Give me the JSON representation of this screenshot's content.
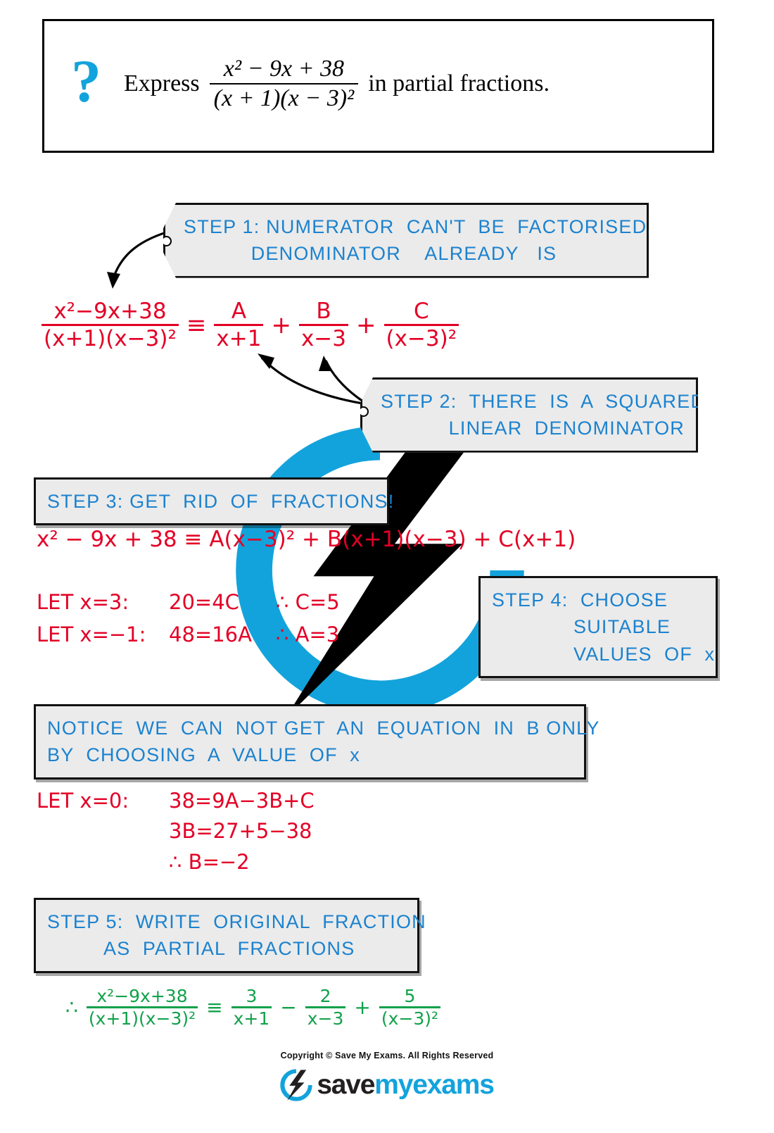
{
  "question": {
    "icon": "question-mark-icon",
    "lead": "Express",
    "trail": "in partial fractions.",
    "fraction": {
      "numerator": "x² − 9x + 38",
      "denominator": "(x + 1)(x − 3)²"
    }
  },
  "steps": [
    {
      "id": "step1",
      "lines": [
        "STEP 1: NUMERATOR  CAN'T  BE  FACTORISED,",
        "DENOMINATOR    ALREADY   IS"
      ]
    },
    {
      "id": "step2",
      "lines": [
        "STEP 2:  THERE  IS  A  SQUARED",
        "LINEAR  DENOMINATOR"
      ]
    },
    {
      "id": "step3",
      "lines": [
        "STEP 3: GET  RID  OF  FRACTIONS!"
      ]
    },
    {
      "id": "step4",
      "lines": [
        "STEP 4:  CHOOSE",
        "SUITABLE",
        "VALUES  OF  x"
      ]
    },
    {
      "id": "notice",
      "lines": [
        "NOTICE  WE  CAN  NOT GET  AN  EQUATION  IN  B ONLY",
        "BY  CHOOSING  A  VALUE  OF  x"
      ]
    },
    {
      "id": "step5",
      "lines": [
        "STEP 5:  WRITE  ORIGINAL  FRACTION",
        "AS  PARTIAL  FRACTIONS"
      ]
    }
  ],
  "work": {
    "line1": {
      "lhs": {
        "num": "x²−9x+38",
        "den": "(x+1)(x−3)²"
      },
      "equiv": "≡",
      "t1": {
        "num": "A",
        "den": "x+1"
      },
      "plus1": "+",
      "t2": {
        "num": "B",
        "den": "x−3"
      },
      "plus2": "+",
      "t3": {
        "num": "C",
        "den": "(x−3)²"
      }
    },
    "line3": "x² − 9x + 38 ≡ A(x−3)² + B(x+1)(x−3) + C(x+1)",
    "let1": {
      "let": "LET  x=3:",
      "eq": "20=4C",
      "result": "∴ C=5"
    },
    "let2": {
      "let": "LET  x=−1:",
      "eq": "48=16A",
      "result": "∴ A=3"
    },
    "let3": {
      "let": "LET  x=0:",
      "eq": "38=9A−3B+C"
    },
    "let4": "3B=27+5−38",
    "let5": "∴  B=−2",
    "answer": {
      "therefore": "∴",
      "lhs": {
        "num": "x²−9x+38",
        "den": "(x+1)(x−3)²"
      },
      "equiv": "≡",
      "t1": {
        "num": "3",
        "den": "x+1"
      },
      "minus": "−",
      "t2": {
        "num": "2",
        "den": "x−3"
      },
      "plus": "+",
      "t3": {
        "num": "5",
        "den": "(x−3)²"
      }
    }
  },
  "footer": {
    "copyright": "Copyright © Save My Exams. All Rights Reserved",
    "logo": {
      "save": "save",
      "my": "my",
      "exams": "exams"
    }
  },
  "colors": {
    "brand_blue": "#13a3dc",
    "text_blue": "#1b82cf",
    "red": "#e30026",
    "green": "#12a14b",
    "box_fill": "#ebebeb",
    "black": "#111111"
  }
}
